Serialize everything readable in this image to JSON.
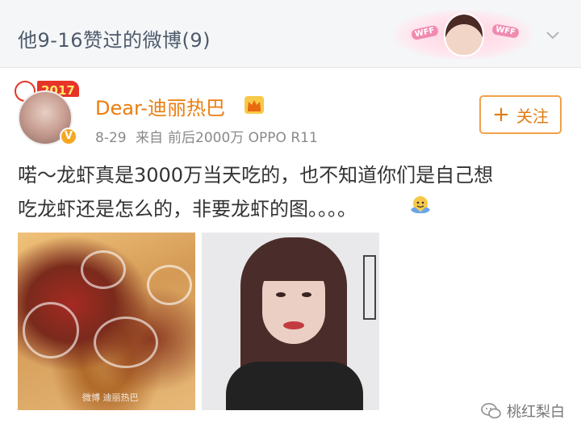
{
  "header": {
    "title": "他9-16赞过的微博(9)",
    "banner_badge_left": "WFF",
    "banner_badge_right": "WFF"
  },
  "post": {
    "avatar_badge": "2017",
    "verified_mark": "V",
    "username": "Dear-迪丽热巴",
    "date": "8-29",
    "source_prefix": "来自",
    "source": "前后2000万 OPPO R11",
    "follow_label": "关注",
    "text": "喏～龙虾真是3000万当天吃的，也不知道你们是自己想吃龙虾还是怎么的，非要龙虾的图。。。。",
    "image1_watermark": "微博 迪丽热巴",
    "icons": [
      "chevron-down-icon",
      "crown-icon",
      "plus-icon",
      "emoji-icon",
      "verified-icon"
    ]
  },
  "watermark": {
    "text": "桃红梨白"
  },
  "colors": {
    "username": "#eb7e10",
    "follow_border": "#f0a14b",
    "header_text": "#4d5a6a",
    "body_text": "#333333"
  }
}
